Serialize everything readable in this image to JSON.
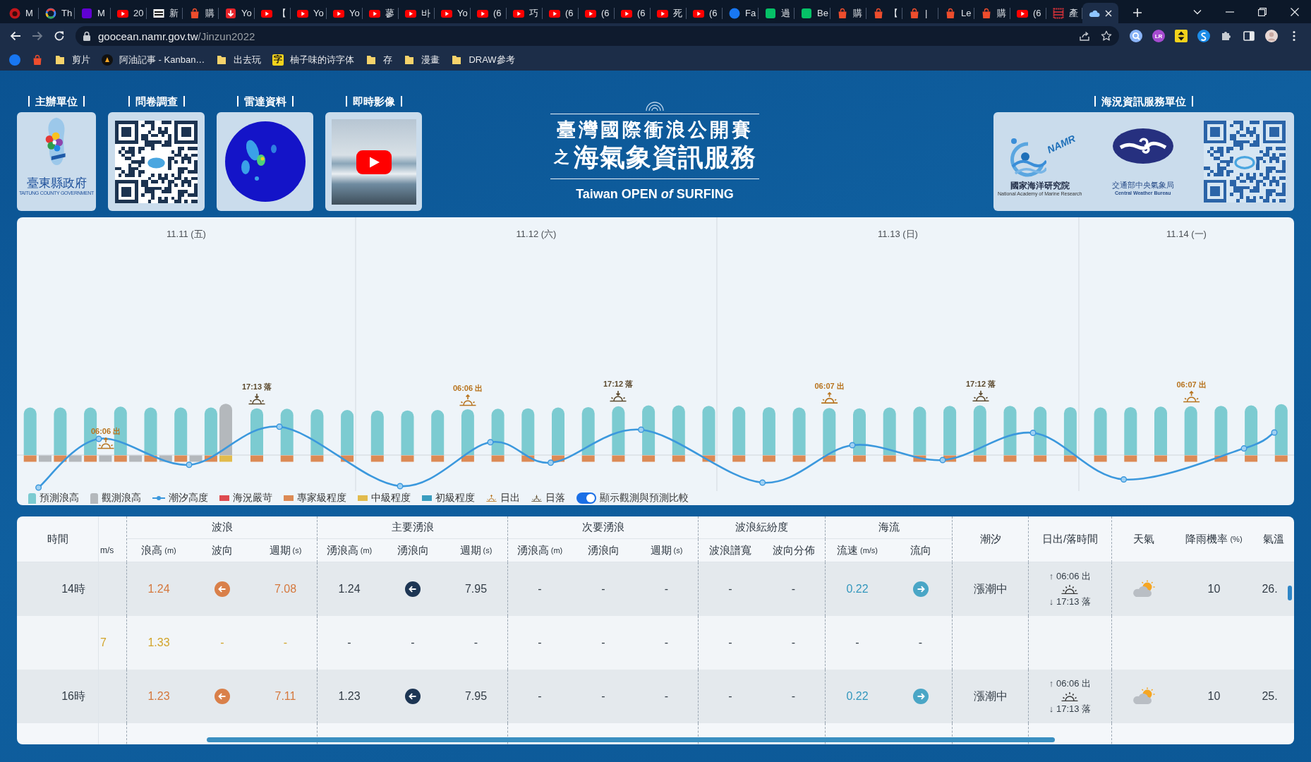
{
  "browser": {
    "tabs": [
      {
        "kind": "badge",
        "title": "M",
        "selected": false
      },
      {
        "kind": "ring",
        "title": "Th",
        "selected": false
      },
      {
        "kind": "square",
        "title": "M",
        "selected": false
      },
      {
        "kind": "play",
        "title": "20",
        "selected": false
      },
      {
        "kind": "letters",
        "title": "新",
        "selected": false
      },
      {
        "kind": "bag",
        "title": "購",
        "selected": false
      },
      {
        "kind": "arrow",
        "title": "Yo",
        "selected": false
      },
      {
        "kind": "play",
        "title": "【",
        "selected": false
      },
      {
        "kind": "play",
        "title": "Yo",
        "selected": false
      },
      {
        "kind": "play",
        "title": "Yo",
        "selected": false
      },
      {
        "kind": "play",
        "title": "蓼",
        "selected": false
      },
      {
        "kind": "play",
        "title": "바",
        "selected": false
      },
      {
        "kind": "play",
        "title": "Yo",
        "selected": false
      },
      {
        "kind": "play",
        "title": "(6",
        "selected": false
      },
      {
        "kind": "play",
        "title": "巧",
        "selected": false
      },
      {
        "kind": "play",
        "title": "(6",
        "selected": false
      },
      {
        "kind": "play",
        "title": "(6",
        "selected": false
      },
      {
        "kind": "play",
        "title": "(6",
        "selected": false
      },
      {
        "kind": "play",
        "title": "死",
        "selected": false
      },
      {
        "kind": "play",
        "title": "(6",
        "selected": false
      },
      {
        "kind": "round",
        "title": "Fa",
        "selected": false
      },
      {
        "kind": "tile",
        "title": "過",
        "selected": false
      },
      {
        "kind": "tile",
        "title": "Be",
        "selected": false
      },
      {
        "kind": "bag",
        "title": "購",
        "selected": false
      },
      {
        "kind": "bag",
        "title": "【",
        "selected": false
      },
      {
        "kind": "bag",
        "title": "|",
        "selected": false
      },
      {
        "kind": "bag",
        "title": "Le",
        "selected": false
      },
      {
        "kind": "bag",
        "title": "購",
        "selected": false
      },
      {
        "kind": "play",
        "title": "(6",
        "selected": false
      },
      {
        "kind": "grid",
        "title": "產",
        "selected": false
      },
      {
        "kind": "cloud",
        "selected": true
      }
    ],
    "navigation": {
      "back_disabled": false,
      "forward_disabled": true
    },
    "url": {
      "host": "goocean.namr.gov.tw",
      "path": "/Jinzun2022"
    },
    "extension_badge": "LR",
    "bookmarks": [
      {
        "kind": "round"
      },
      {
        "kind": "bag"
      },
      {
        "kind": "folder",
        "label": "剪片"
      },
      {
        "kind": "app",
        "label": "阿油記事 - Kanban…"
      },
      {
        "kind": "folder",
        "label": "出去玩"
      },
      {
        "kind": "glyph",
        "glyph": "字",
        "label": "柚子味的诗字体"
      },
      {
        "kind": "folder",
        "label": "存"
      },
      {
        "kind": "folder",
        "label": "漫畫"
      },
      {
        "kind": "folder",
        "label": "DRAW參考"
      }
    ]
  },
  "header": {
    "organizers": [
      {
        "label": "主辦單位",
        "kind": "emblem",
        "name": "臺東縣政府",
        "name_en": "TAITUNG COUNTY GOVERNMENT"
      },
      {
        "label": "問卷調查",
        "kind": "qr"
      },
      {
        "label": "雷達資料",
        "kind": "radar"
      },
      {
        "label": "即時影像",
        "kind": "video"
      }
    ],
    "title": {
      "line1": "臺灣國際衝浪公開賽",
      "prefix": "之",
      "line2": "海氣象資訊服務",
      "event": "Taiwan OPEN *of* SURFING"
    },
    "services": {
      "label": "海況資訊服務單位",
      "items": [
        {
          "kind": "waves",
          "logo_text": "NAMR",
          "name": "國家海洋研究院",
          "name_en": "National Academy of Marine Research"
        },
        {
          "kind": "oval",
          "name": "交通部中央氣象局",
          "name_en": "Central Weather Bureau"
        },
        {
          "kind": "qr"
        }
      ]
    }
  },
  "chart": {
    "days": [
      "11.11 (五)",
      "11.12 (六)",
      "11.13 (日)",
      "11.14 (一)"
    ],
    "sun_markers": [
      {
        "kind": "sunrise",
        "label": "06:06 出"
      },
      {
        "kind": "sunset",
        "label": "17:13 落"
      },
      {
        "kind": "sunrise",
        "label": "06:06 出"
      },
      {
        "kind": "sunset",
        "label": "17:12 落"
      },
      {
        "kind": "sunrise",
        "label": "06:07 出"
      },
      {
        "kind": "sunset",
        "label": "17:12 落"
      },
      {
        "kind": "sunrise",
        "label": "06:07 出"
      }
    ],
    "legend": [
      {
        "kind": "bar",
        "label": "預測浪高",
        "color": "#7ccbd1"
      },
      {
        "kind": "bar",
        "label": "觀測浪高",
        "color": "#b4b8bc"
      },
      {
        "kind": "line",
        "label": "潮汐高度",
        "color": "#3b98dd"
      },
      {
        "kind": "swatch",
        "label": "海況嚴苛",
        "color": "#de4b50"
      },
      {
        "kind": "swatch",
        "label": "專家級程度",
        "color": "#dc8a55"
      },
      {
        "kind": "swatch",
        "label": "中級程度",
        "color": "#e2bb4c"
      },
      {
        "kind": "swatch",
        "label": "初級程度",
        "color": "#3a9dbf"
      },
      {
        "kind": "sunrise",
        "label": "日出"
      },
      {
        "kind": "sunset",
        "label": "日落"
      }
    ],
    "toggle": {
      "label": "顯示觀測與預測比較",
      "on": true
    }
  },
  "table": {
    "headers": [
      {
        "kind": "single",
        "label": "時間"
      },
      {
        "kind": "cut",
        "unit": "m/s"
      },
      {
        "kind": "group",
        "label": "波浪",
        "sub": [
          {
            "label": "浪高",
            "unit": "(m)"
          },
          {
            "label": "波向"
          },
          {
            "label": "週期",
            "unit": "(s)"
          }
        ]
      },
      {
        "kind": "group",
        "label": "主要湧浪",
        "sub": [
          {
            "label": "湧浪高",
            "unit": "(m)"
          },
          {
            "label": "湧浪向"
          },
          {
            "label": "週期",
            "unit": "(s)"
          }
        ]
      },
      {
        "kind": "group",
        "label": "次要湧浪",
        "sub": [
          {
            "label": "湧浪高",
            "unit": "(m)"
          },
          {
            "label": "湧浪向"
          },
          {
            "label": "週期",
            "unit": "(s)"
          }
        ]
      },
      {
        "kind": "group",
        "label": "波浪紜紛度",
        "sub": [
          {
            "label": "波浪譜寬"
          },
          {
            "label": "波向分佈"
          }
        ]
      },
      {
        "kind": "group",
        "label": "海流",
        "sub": [
          {
            "label": "流速",
            "unit": "(m/s)"
          },
          {
            "label": "流向"
          }
        ]
      },
      {
        "kind": "single",
        "label": "潮汐"
      },
      {
        "kind": "single",
        "label": "日出/落時間"
      },
      {
        "kind": "single",
        "label": "天氣"
      },
      {
        "kind": "single",
        "label": "降雨機率",
        "unit": "(%)"
      },
      {
        "kind": "single",
        "label": "氣溫"
      }
    ],
    "rows": [
      {
        "time": "14時",
        "cells": [
          {
            "kind": "blank"
          },
          {
            "kind": "text",
            "text": "1.24",
            "color": "#d5783d"
          },
          {
            "kind": "left",
            "color": "#d9804a"
          },
          {
            "kind": "text",
            "text": "7.08",
            "color": "#d5783d"
          },
          {
            "kind": "text",
            "text": "1.24"
          },
          {
            "kind": "left",
            "color": "#1d3654"
          },
          {
            "kind": "text",
            "text": "7.95"
          },
          {
            "kind": "text",
            "text": "-"
          },
          {
            "kind": "text",
            "text": "-"
          },
          {
            "kind": "text",
            "text": "-"
          },
          {
            "kind": "text",
            "text": "-"
          },
          {
            "kind": "text",
            "text": "-"
          },
          {
            "kind": "text",
            "text": "0.22",
            "color": "#3397bd"
          },
          {
            "kind": "right",
            "color": "#4aa6c6"
          },
          {
            "kind": "text",
            "text": "漲潮中"
          },
          {
            "kind": "sun",
            "rise": "↑ 06:06 出",
            "set": "↓ 17:13 落"
          },
          {
            "kind": "weather"
          },
          {
            "kind": "text",
            "text": "10"
          },
          {
            "kind": "text",
            "text": "26."
          }
        ]
      },
      {
        "cells": [
          {
            "kind": "text",
            "text": "7",
            "color": "#d2a42a"
          },
          {
            "kind": "text",
            "text": "1.33",
            "color": "#d2a42a"
          },
          {
            "kind": "text",
            "text": "-",
            "color": "#d2a42a"
          },
          {
            "kind": "text",
            "text": "-",
            "color": "#d2a42a"
          },
          {
            "kind": "text",
            "text": "-"
          },
          {
            "kind": "text",
            "text": "-"
          },
          {
            "kind": "text",
            "text": "-"
          },
          {
            "kind": "text",
            "text": "-"
          },
          {
            "kind": "text",
            "text": "-"
          },
          {
            "kind": "text",
            "text": "-"
          },
          {
            "kind": "text",
            "text": "-"
          },
          {
            "kind": "text",
            "text": "-"
          },
          {
            "kind": "text",
            "text": "-"
          },
          {
            "kind": "text",
            "text": "-"
          },
          {
            "kind": "blank"
          },
          {
            "kind": "blank"
          },
          {
            "kind": "blank"
          },
          {
            "kind": "blank"
          },
          {
            "kind": "blank"
          }
        ]
      },
      {
        "time": "16時",
        "cells": [
          {
            "kind": "blank"
          },
          {
            "kind": "text",
            "text": "1.23",
            "color": "#d5783d"
          },
          {
            "kind": "left",
            "color": "#d9804a"
          },
          {
            "kind": "text",
            "text": "7.11",
            "color": "#d5783d"
          },
          {
            "kind": "text",
            "text": "1.23"
          },
          {
            "kind": "left",
            "color": "#1d3654"
          },
          {
            "kind": "text",
            "text": "7.95"
          },
          {
            "kind": "text",
            "text": "-"
          },
          {
            "kind": "text",
            "text": "-"
          },
          {
            "kind": "text",
            "text": "-"
          },
          {
            "kind": "text",
            "text": "-"
          },
          {
            "kind": "text",
            "text": "-"
          },
          {
            "kind": "text",
            "text": "0.22",
            "color": "#3397bd"
          },
          {
            "kind": "right",
            "color": "#4aa6c6"
          },
          {
            "kind": "text",
            "text": "漲潮中"
          },
          {
            "kind": "sun",
            "rise": "↑ 06:06 出",
            "set": "↓ 17:13 落"
          },
          {
            "kind": "weather"
          },
          {
            "kind": "text",
            "text": "10"
          },
          {
            "kind": "text",
            "text": "25."
          }
        ]
      }
    ]
  }
}
